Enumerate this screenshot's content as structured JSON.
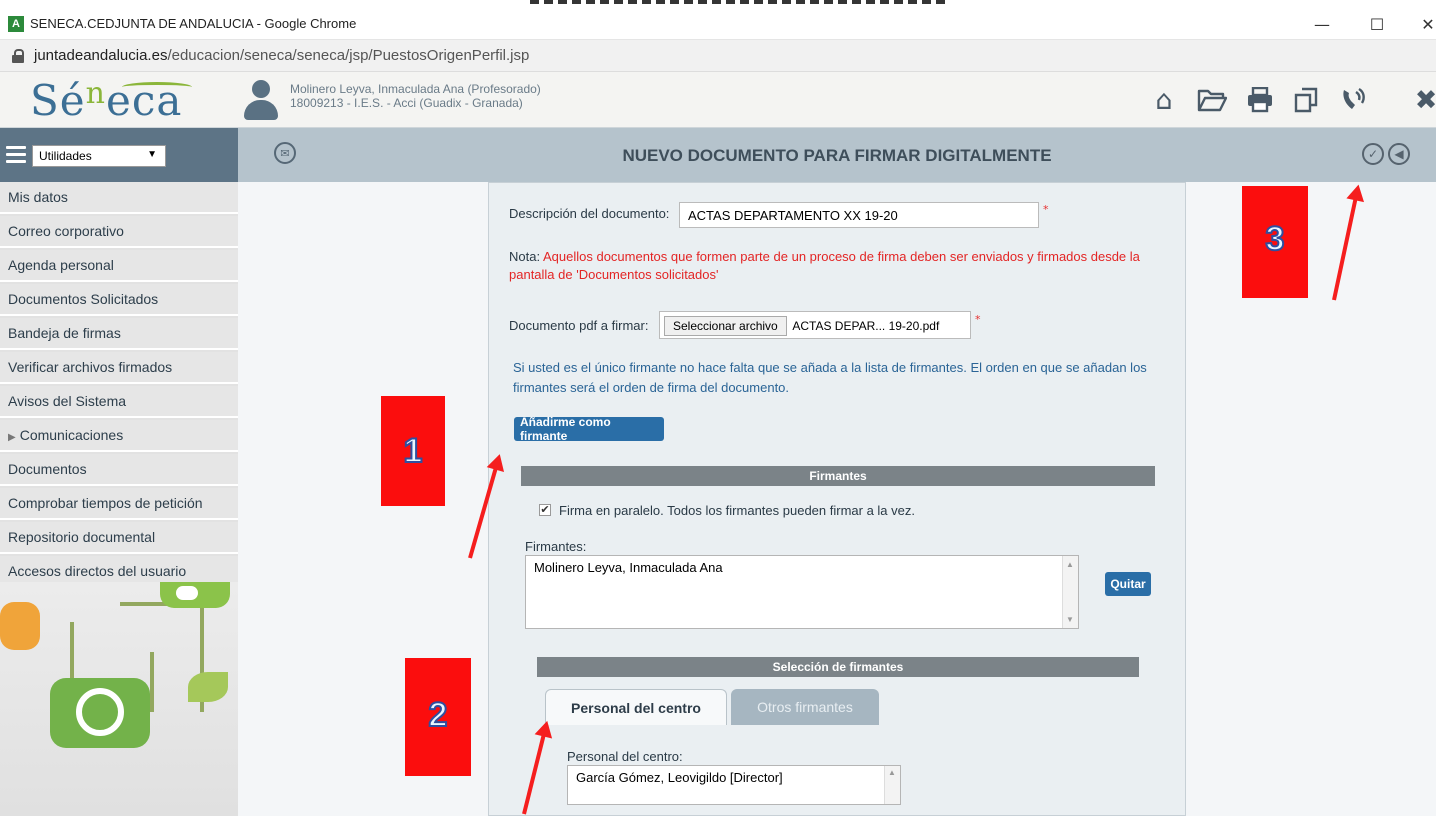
{
  "window": {
    "title": "SENECA.CEDJUNTA DE ANDALUCIA - Google Chrome",
    "app_icon": "A",
    "minimize": "—",
    "maximize": "☐",
    "close": "✕"
  },
  "address_bar": {
    "url_host": "juntadeandalucia.es",
    "url_path": "/educacion/seneca/seneca/jsp/PuestosOrigenPerfil.jsp"
  },
  "header": {
    "logo_left": "Sé",
    "logo_n": "n",
    "logo_right": "eca",
    "user_name": "Molinero Leyva, Inmaculada Ana (Profesorado)",
    "user_center": "18009213 - I.E.S. - Acci (Guadix - Granada)",
    "icons": [
      "home-icon",
      "folder-open-icon",
      "print-icon",
      "copy-icon",
      "phone-icon",
      "close-icon"
    ]
  },
  "sidebar_top": {
    "select_value": "Utilidades"
  },
  "toolbar": {
    "page_title": "NUEVO DOCUMENTO PARA FIRMAR DIGITALMENTE"
  },
  "sidebar": {
    "items": [
      {
        "label": "Mis datos"
      },
      {
        "label": "Correo corporativo"
      },
      {
        "label": "Agenda personal"
      },
      {
        "label": "Documentos Solicitados"
      },
      {
        "label": "Bandeja de firmas"
      },
      {
        "label": "Verificar archivos firmados"
      },
      {
        "label": "Avisos del Sistema"
      },
      {
        "label": "Comunicaciones"
      },
      {
        "label": "Documentos"
      },
      {
        "label": "Comprobar tiempos de petición"
      },
      {
        "label": "Repositorio documental"
      },
      {
        "label": "Accesos directos del usuario"
      }
    ]
  },
  "form": {
    "desc_label": "Descripción del documento:",
    "desc_value": "ACTAS DEPARTAMENTO XX 19-20",
    "required_mark": "*",
    "note_prefix": "Nota:",
    "note_text": "Aquellos documentos que formen parte de un proceso de firma deben ser enviados y firmados desde la pantalla de 'Documentos solicitados'",
    "pdf_label": "Documento pdf a firmar:",
    "file_button": "Seleccionar archivo",
    "file_name": "ACTAS DEPAR... 19-20.pdf",
    "info_text": "Si usted es el único firmante no hace falta que se añada a la lista de firmantes. El orden en que se añadan los firmantes será el orden de firma del documento.",
    "add_me_button": "Añadirme como firmante",
    "signers_section": "Firmantes",
    "parallel_label": "Firma en paralelo. Todos los firmantes pueden firmar a la vez.",
    "signers_label": "Firmantes:",
    "signers_list": [
      "Molinero Leyva, Inmaculada Ana"
    ],
    "remove_button": "Quitar",
    "selection_section": "Selección de firmantes",
    "tab_staff": "Personal del centro",
    "tab_others": "Otros firmantes",
    "staff_label": "Personal del centro:",
    "staff_first": "García Gómez, Leovigildo [Director]"
  },
  "annotations": {
    "marker_1": "1",
    "marker_2": "2",
    "marker_3": "3"
  }
}
